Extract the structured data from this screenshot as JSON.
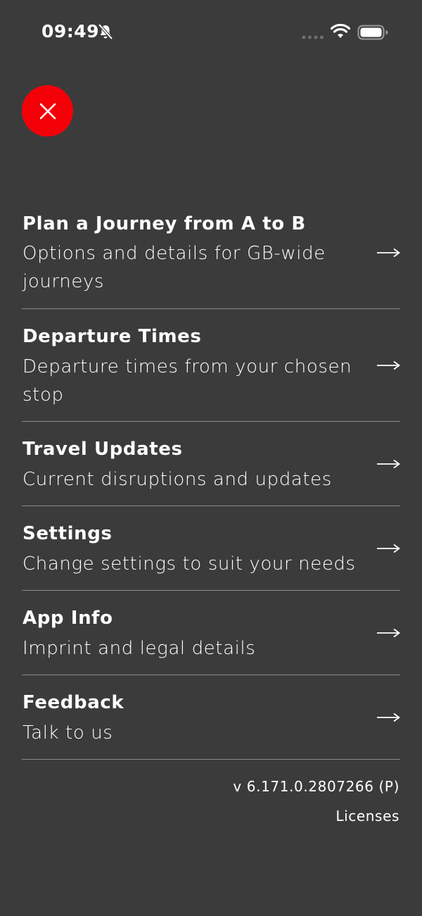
{
  "status_bar": {
    "time": "09:49"
  },
  "close_button": {
    "icon": "close-icon",
    "color": "#f40009"
  },
  "menu": {
    "items": [
      {
        "title": "Plan a Journey from A to B",
        "subtitle": "Options and details for GB-wide journeys"
      },
      {
        "title": "Departure Times",
        "subtitle": "Departure times from your chosen stop"
      },
      {
        "title": "Travel Updates",
        "subtitle": "Current disruptions and updates"
      },
      {
        "title": "Settings",
        "subtitle": "Change settings to suit your needs"
      },
      {
        "title": "App Info",
        "subtitle": "Imprint and legal details"
      },
      {
        "title": "Feedback",
        "subtitle": "Talk to us"
      }
    ]
  },
  "footer": {
    "version": "v 6.171.0.2807266 (P)",
    "licenses": "Licenses"
  },
  "colors": {
    "background": "#3b3b3b",
    "accent": "#f40009",
    "text": "#ffffff",
    "divider": "#8a8a8a"
  }
}
